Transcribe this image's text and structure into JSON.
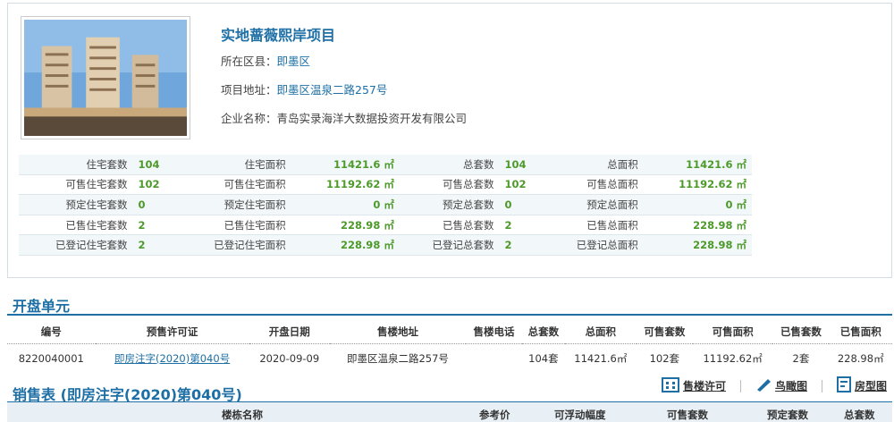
{
  "project": {
    "name": "实地蔷薇熙岸项目",
    "district_label": "所在区县：",
    "district": "即墨区",
    "address_label": "项目地址：",
    "address": "即墨区温泉二路257号",
    "company_label": "企业名称：",
    "company": "青岛实录海洋大数据投资开发有限公司"
  },
  "stats": [
    [
      "住宅套数",
      "104",
      "住宅面积",
      "11421.6 ㎡",
      "总套数",
      "104",
      "总面积",
      "11421.6 ㎡"
    ],
    [
      "可售住宅套数",
      "102",
      "可售住宅面积",
      "11192.62 ㎡",
      "可售总套数",
      "102",
      "可售总面积",
      "11192.62 ㎡"
    ],
    [
      "预定住宅套数",
      "0",
      "预定住宅面积",
      "0 ㎡",
      "预定总套数",
      "0",
      "预定总面积",
      "0 ㎡"
    ],
    [
      "已售住宅套数",
      "2",
      "已售住宅面积",
      "228.98 ㎡",
      "已售总套数",
      "2",
      "已售总面积",
      "228.98 ㎡"
    ],
    [
      "已登记住宅套数",
      "2",
      "已登记住宅面积",
      "228.98 ㎡",
      "已登记总套数",
      "2",
      "已登记总面积",
      "228.98 ㎡"
    ]
  ],
  "units_section": {
    "title": "开盘单元",
    "headers": [
      "编号",
      "预售许可证",
      "开盘日期",
      "售楼地址",
      "售楼电话",
      "总套数",
      "总面积",
      "可售套数",
      "可售面积",
      "已售套数",
      "已售面积"
    ],
    "row": [
      "8220040001",
      "即房注字(2020)第040号",
      "2020-09-09",
      "即墨区温泉二路257号",
      "",
      "104套",
      "11421.6㎡",
      "102套",
      "11192.62㎡",
      "2套",
      "228.98㎡"
    ]
  },
  "sales_section": {
    "title": "销售表 (即房注字(2020)第040号)",
    "links": [
      "售楼许可",
      "鸟瞰图",
      "房型图"
    ],
    "headers": [
      "楼栋名称",
      "参考价",
      "可浮动幅度",
      "可售套数",
      "预定套数",
      "总套数"
    ]
  },
  "colors": {
    "accent": "#1d6fa5",
    "value_green": "#4d9a2a"
  }
}
